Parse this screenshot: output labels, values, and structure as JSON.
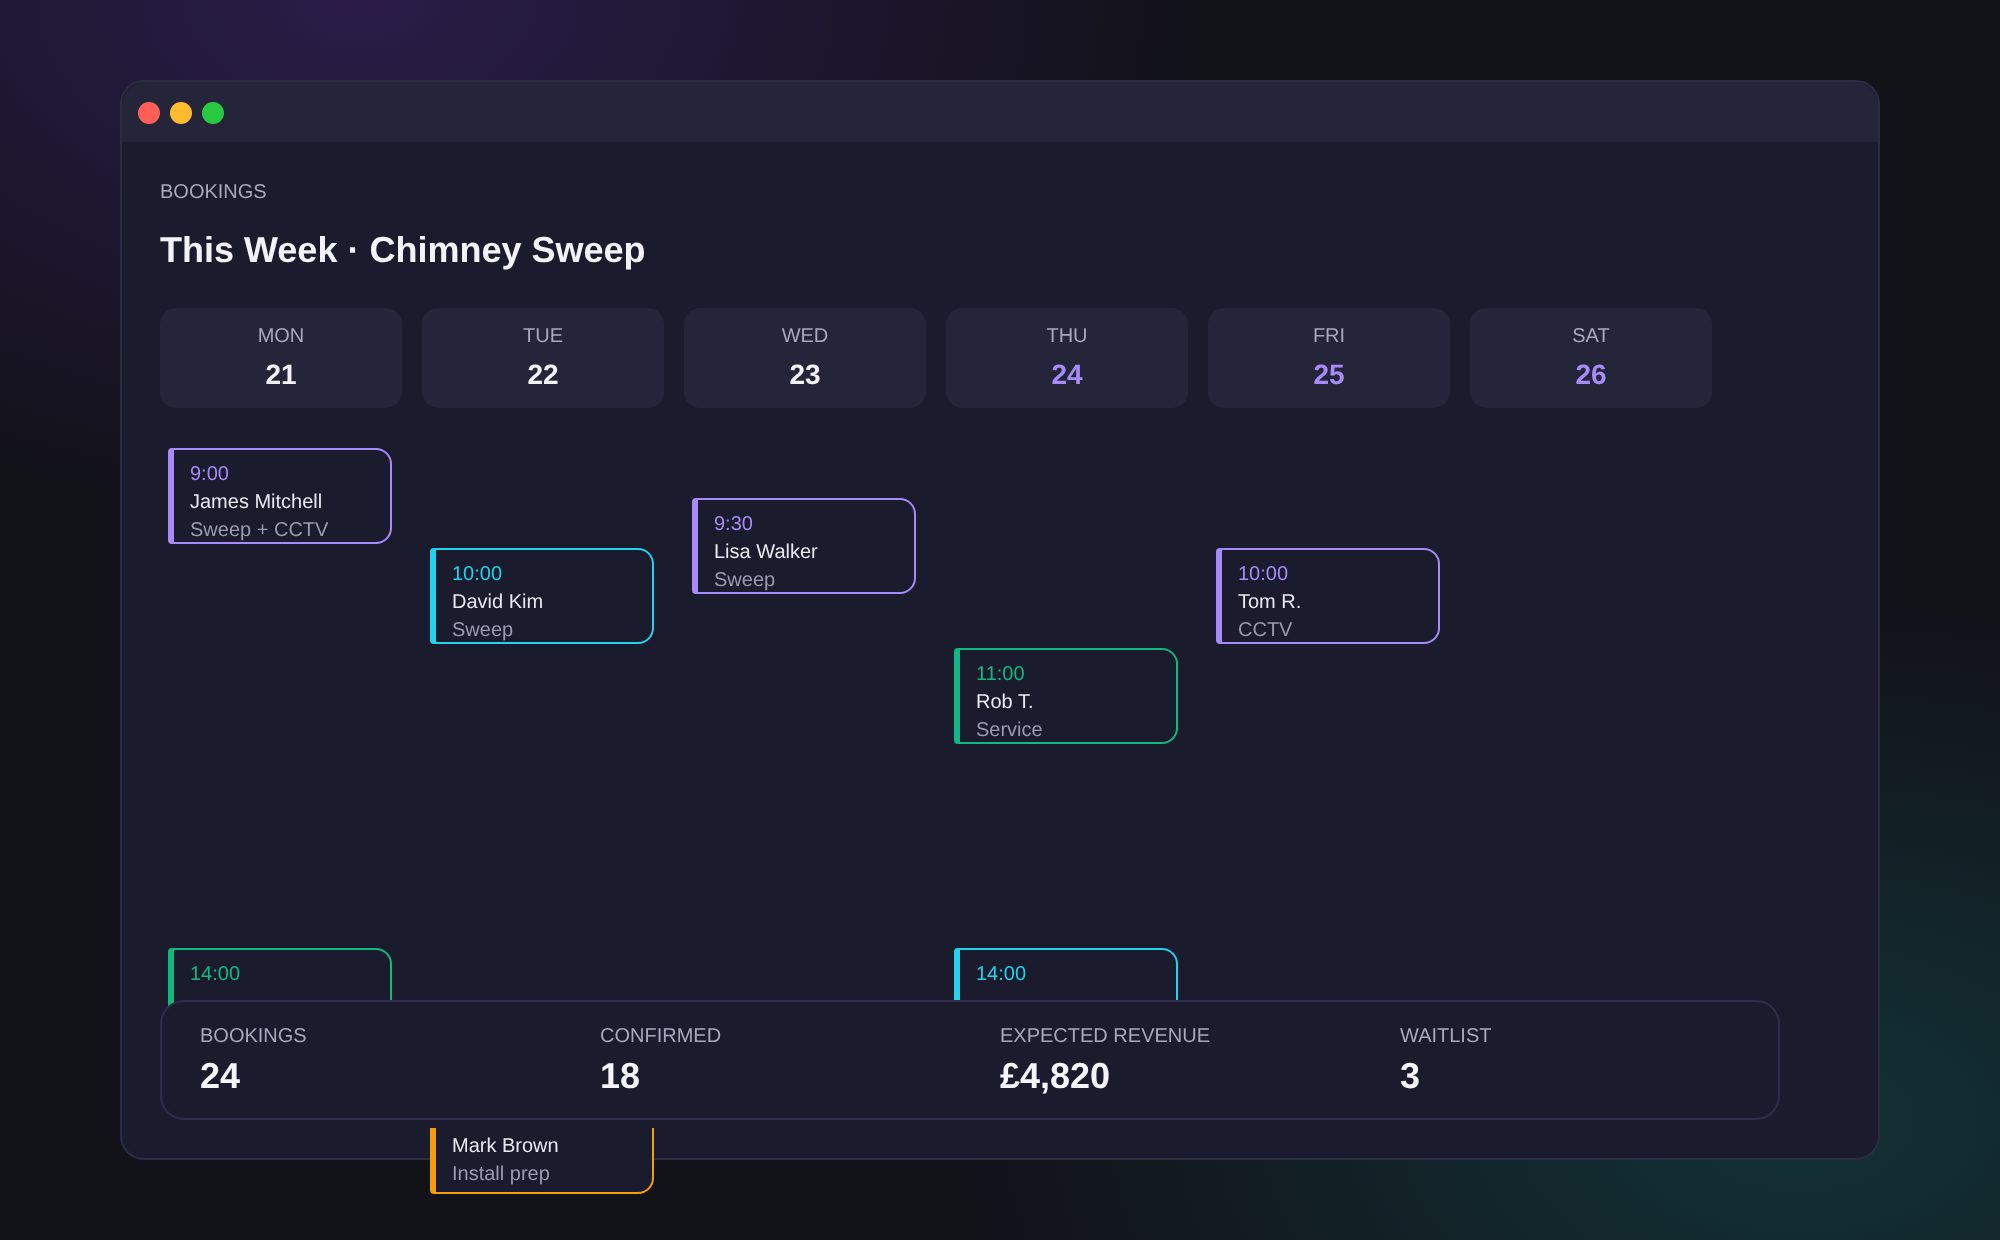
{
  "section_label": "BOOKINGS",
  "title": "This Week · Chimney Sweep",
  "days": [
    {
      "name": "MON",
      "date": "21",
      "highlighted": false,
      "bookings": [
        {
          "kind": "full",
          "time": "9:00",
          "customer": "James Mitchell",
          "service": "Sweep + CCTV",
          "color": "#a78bfa"
        },
        {
          "kind": "top-visible",
          "time": "14:00",
          "color": "#10b981"
        }
      ]
    },
    {
      "name": "TUE",
      "date": "22",
      "highlighted": false,
      "bookings": [
        {
          "kind": "full",
          "time": "10:00",
          "customer": "David Kim",
          "service": "Sweep",
          "color": "#22d3ee"
        },
        {
          "kind": "bottom-visible",
          "customer": "Mark Brown",
          "service": "Install prep",
          "color": "#f59e0b"
        }
      ]
    },
    {
      "name": "WED",
      "date": "23",
      "highlighted": false,
      "bookings": [
        {
          "kind": "full",
          "time": "9:30",
          "customer": "Lisa Walker",
          "service": "Sweep",
          "color": "#a78bfa"
        }
      ]
    },
    {
      "name": "THU",
      "date": "24",
      "highlighted": true,
      "bookings": [
        {
          "kind": "full",
          "time": "11:00",
          "customer": "Rob T.",
          "service": "Service",
          "color": "#10b981"
        },
        {
          "kind": "top-visible",
          "time": "14:00",
          "color": "#22d3ee"
        }
      ]
    },
    {
      "name": "FRI",
      "date": "25",
      "highlighted": true,
      "bookings": [
        {
          "kind": "full",
          "time": "10:00",
          "customer": "Tom R.",
          "service": "CCTV",
          "color": "#a78bfa"
        }
      ]
    },
    {
      "name": "SAT",
      "date": "26",
      "highlighted": true
    }
  ],
  "stats": [
    {
      "label": "BOOKINGS",
      "value": "24"
    },
    {
      "label": "CONFIRMED",
      "value": "18"
    },
    {
      "label": "EXPECTED REVENUE",
      "value": "£4,820"
    },
    {
      "label": "WAITLIST",
      "value": "3"
    }
  ]
}
